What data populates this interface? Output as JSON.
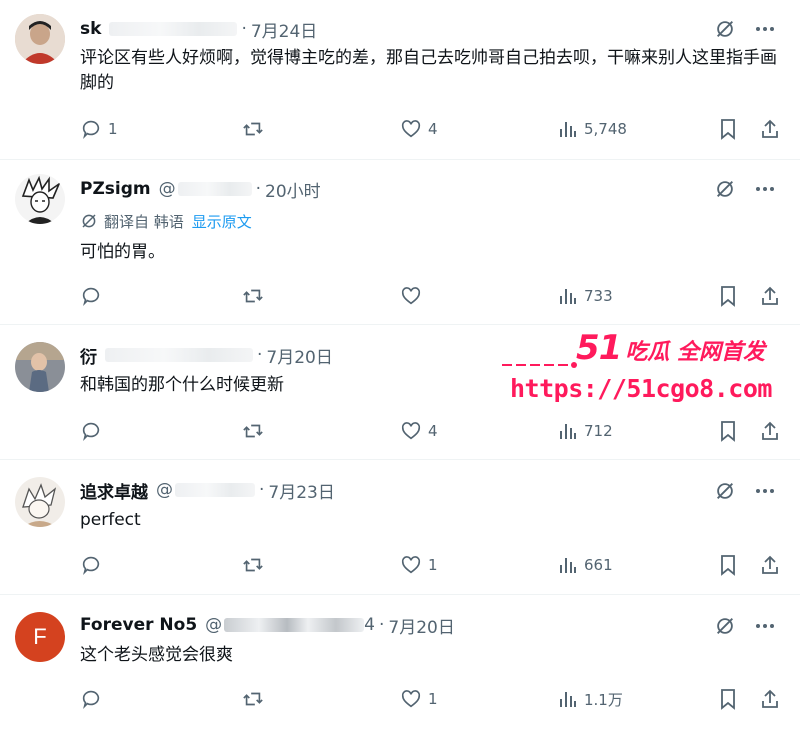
{
  "replies": [
    {
      "name": "sk",
      "handle_prefix": "",
      "time": "7月24日",
      "text": "评论区有些人好烦啊，觉得博主吃的差，那自己去吃帅哥自己拍去呗，干嘛来别人这里指手画脚的",
      "translate": null,
      "reply_count": "1",
      "retweet_count": "",
      "like_count": "4",
      "view_count": "5,748",
      "avatar": "photo-avatar"
    },
    {
      "name": "PZsigm",
      "handle_prefix": "@",
      "time": "20小时",
      "text": "可怕的胃。",
      "translate": {
        "label": "翻译自 韩语",
        "link": "显示原文"
      },
      "reply_count": "",
      "retweet_count": "",
      "like_count": "",
      "view_count": "733",
      "avatar": "sketch-avatar"
    },
    {
      "name": "衍",
      "handle_prefix": "",
      "time": "7月20日",
      "text": "和韩国的那个什么时候更新",
      "translate": null,
      "reply_count": "",
      "retweet_count": "",
      "like_count": "4",
      "view_count": "712",
      "avatar": "photo-avatar"
    },
    {
      "name": "追求卓越",
      "handle_prefix": "@",
      "time": "7月23日",
      "text": "perfect",
      "translate": null,
      "reply_count": "",
      "retweet_count": "",
      "like_count": "1",
      "view_count": "661",
      "avatar": "sketch-avatar"
    },
    {
      "name": "Forever No5",
      "handle_prefix": "@",
      "handle_tail": "4",
      "time": "7月20日",
      "text": "这个老头感觉会很爽",
      "translate": null,
      "reply_count": "",
      "retweet_count": "",
      "like_count": "1",
      "view_count": "1.1万",
      "avatar": "letter-avatar",
      "avatar_letter": "F"
    }
  ],
  "separator": "·",
  "watermark": {
    "brand_number": "51",
    "brand_slogan": "吃瓜 全网首发",
    "url": "https://51cgo8.com"
  },
  "colors": {
    "text": "#0f1419",
    "secondary": "#536471",
    "link": "#1d9bf0",
    "divider": "#eff3f4",
    "watermark": "#ff1a5c",
    "letter_avatar_bg": "#d4421f"
  }
}
